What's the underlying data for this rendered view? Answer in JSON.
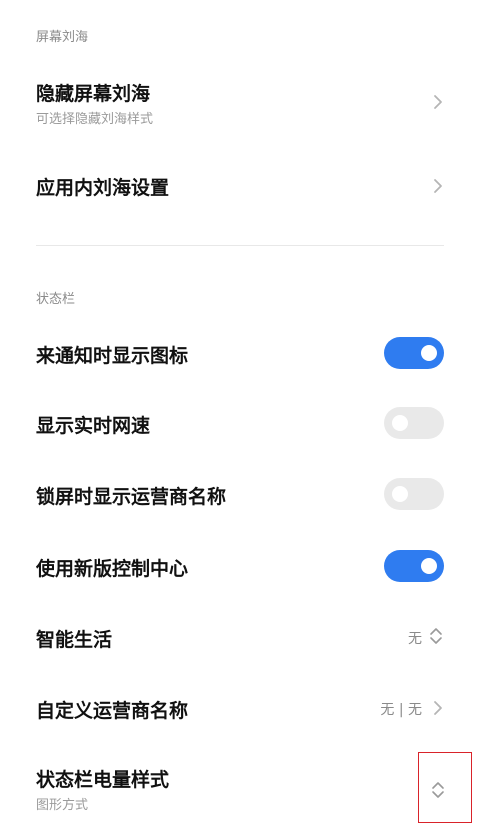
{
  "sections": {
    "notch": {
      "header": "屏幕刘海",
      "hide_notch": {
        "title": "隐藏屏幕刘海",
        "subtitle": "可选择隐藏刘海样式"
      },
      "in_app_notch": {
        "title": "应用内刘海设置"
      }
    },
    "status_bar": {
      "header": "状态栏",
      "notify_icons": {
        "title": "来通知时显示图标",
        "on": true
      },
      "network_speed": {
        "title": "显示实时网速",
        "on": false
      },
      "lock_carrier": {
        "title": "锁屏时显示运营商名称",
        "on": false
      },
      "new_control_center": {
        "title": "使用新版控制中心",
        "on": true
      },
      "smart_life": {
        "title": "智能生活",
        "value": "无"
      },
      "custom_carrier": {
        "title": "自定义运营商名称",
        "value": "无 | 无"
      },
      "battery_style": {
        "title": "状态栏电量样式",
        "subtitle": "图形方式"
      }
    }
  },
  "colors": {
    "toggle_on": "#2f7cf0",
    "toggle_off": "#e9e9e9",
    "highlight_box": "#d9232a"
  },
  "icons": {
    "chevron": "chevron-right-icon",
    "updown": "chevron-up-down-icon"
  }
}
